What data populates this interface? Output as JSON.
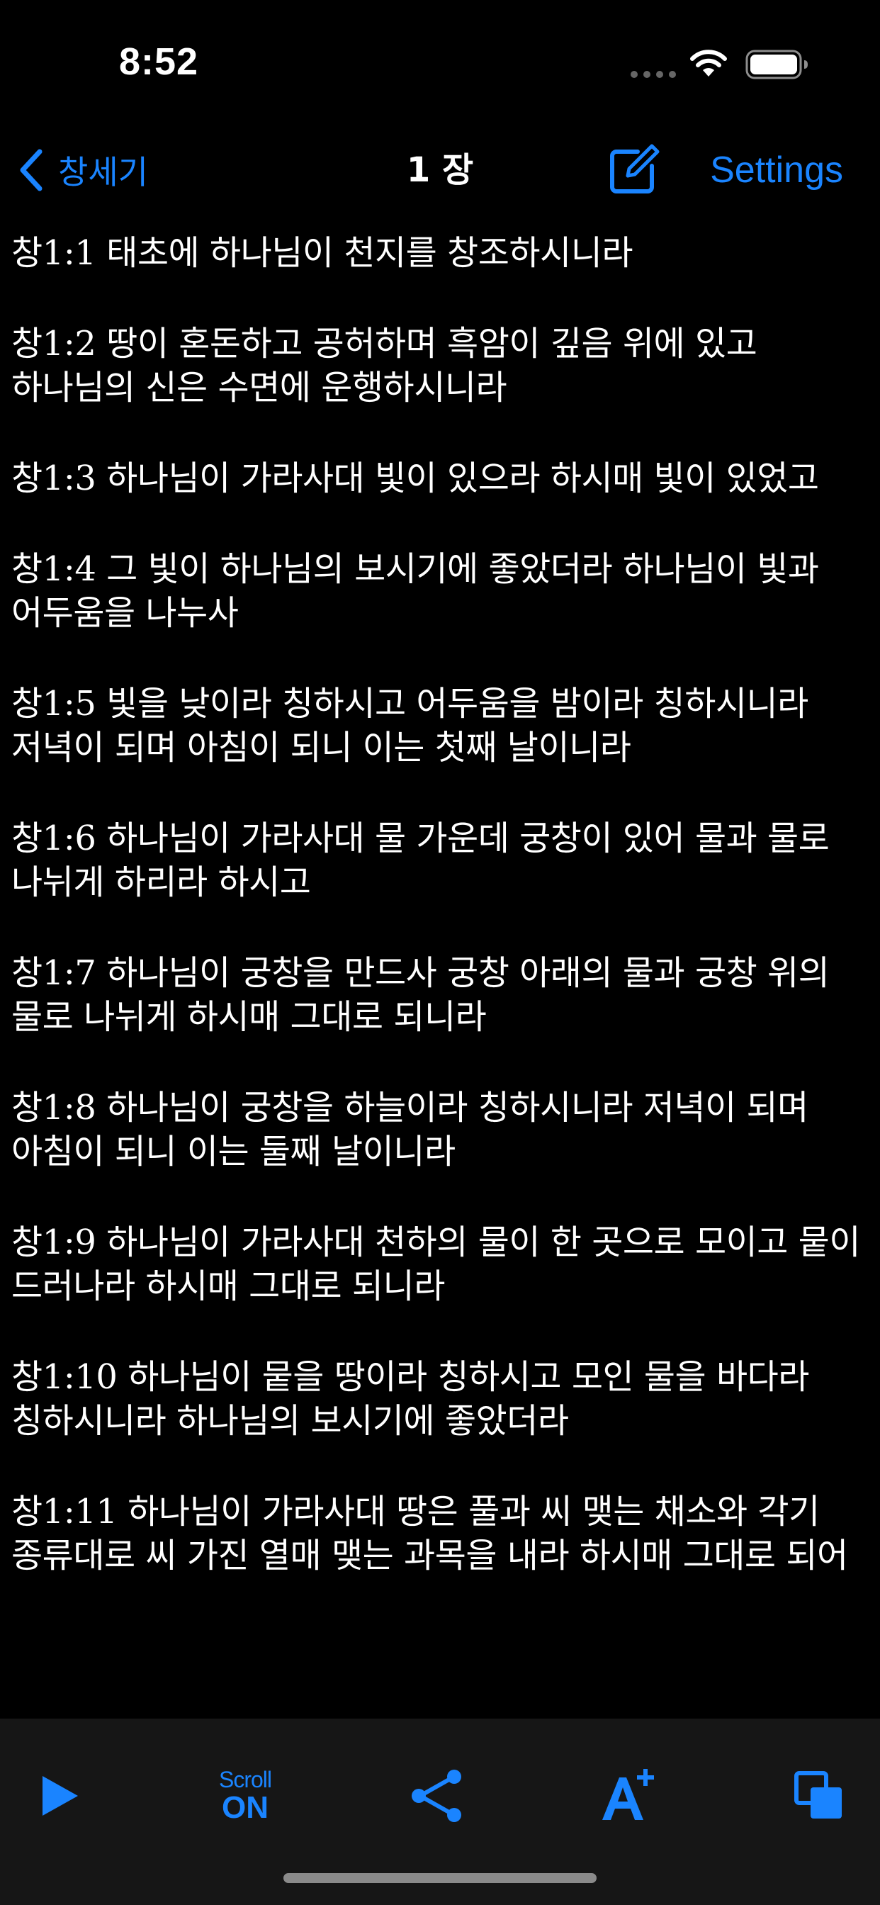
{
  "status_bar": {
    "time": "8:52"
  },
  "nav": {
    "back_label": "창세기",
    "title": "1 장",
    "settings_label": "Settings"
  },
  "verses": [
    {
      "ref": "창1:1",
      "text": " 태초에 하나님이 천지를 창조하시니라"
    },
    {
      "ref": "창1:2",
      "text": " 땅이 혼돈하고 공허하며 흑암이 깊음 위에 있고 하나님의 신은 수면에 운행하시니라"
    },
    {
      "ref": "창1:3",
      "text": " 하나님이 가라사대 빛이 있으라 하시매 빛이 있었고"
    },
    {
      "ref": "창1:4",
      "text": " 그 빛이 하나님의 보시기에 좋았더라 하나님이 빛과 어두움을 나누사"
    },
    {
      "ref": "창1:5",
      "text": " 빛을 낮이라 칭하시고 어두움을 밤이라 칭하시니라 저녁이 되며 아침이 되니 이는 첫째 날이니라"
    },
    {
      "ref": "창1:6",
      "text": " 하나님이 가라사대 물 가운데 궁창이 있어 물과 물로 나뉘게 하리라 하시고"
    },
    {
      "ref": "창1:7",
      "text": " 하나님이 궁창을 만드사 궁창 아래의 물과 궁창 위의 물로 나뉘게 하시매 그대로 되니라"
    },
    {
      "ref": "창1:8",
      "text": " 하나님이 궁창을 하늘이라 칭하시니라 저녁이 되며 아침이 되니 이는 둘째 날이니라"
    },
    {
      "ref": "창1:9",
      "text": " 하나님이 가라사대 천하의 물이 한 곳으로 모이고 뭍이 드러나라 하시매 그대로 되니라"
    },
    {
      "ref": "창1:10",
      "text": " 하나님이 뭍을 땅이라 칭하시고 모인 물을 바다라 칭하시니라 하나님의 보시기에 좋았더라"
    },
    {
      "ref": "창1:11",
      "text": " 하나님이 가라사대 땅은 풀과 씨 맺는 채소와 각기 종류대로 씨 가진 열매 맺는 과목을 내라 하시매 그대로 되어"
    }
  ],
  "toolbar": {
    "scroll_label": "Scroll",
    "scroll_state": "ON",
    "icons": [
      "play-icon",
      "share-icon",
      "font-size-icon",
      "copy-icon"
    ]
  },
  "colors": {
    "accent": "#1a84ff",
    "background": "#000000",
    "toolbar_background": "#161616",
    "text": "#ffffff"
  }
}
